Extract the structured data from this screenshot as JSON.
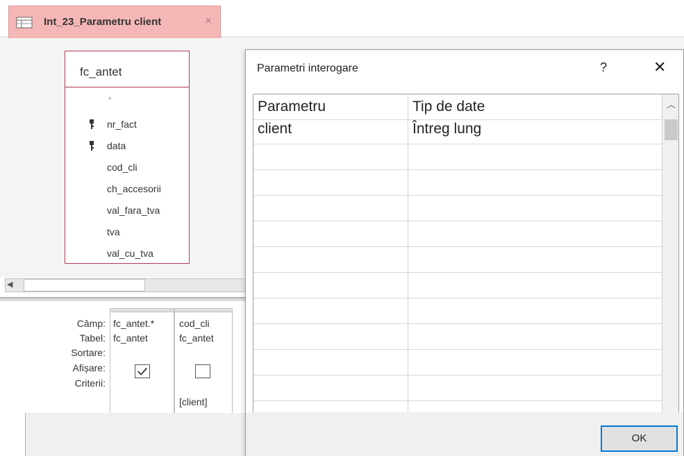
{
  "tab": {
    "title": "Int_23_Parametru client",
    "close": "×"
  },
  "table": {
    "name": "fc_antet",
    "star": "*",
    "fields": [
      "nr_fact",
      "data",
      "cod_cli",
      "ch_accesorii",
      "val_fara_tva",
      "tva",
      "val_cu_tva"
    ]
  },
  "qbe": {
    "labels": {
      "field": "Câmp:",
      "table": "Tabel:",
      "sort": "Sortare:",
      "show": "Afișare:",
      "criteria": "Criterii:"
    },
    "columns": [
      {
        "field": "fc_antet.*",
        "table": "fc_antet",
        "sort": "",
        "show": true,
        "criteria": ""
      },
      {
        "field": "cod_cli",
        "table": "fc_antet",
        "sort": "",
        "show": false,
        "criteria": "[client]"
      }
    ]
  },
  "dialog": {
    "title": "Parametri interogare",
    "help": "?",
    "close": "✕",
    "headers": {
      "param": "Parametru",
      "type": "Tip de date"
    },
    "rows": [
      {
        "param": "client",
        "type": "Întreg lung"
      }
    ],
    "ok": "OK"
  },
  "colors": {
    "tab_bg": "#f5b7b6",
    "table_border": "#b03c4f",
    "ok_border": "#0078d7"
  }
}
